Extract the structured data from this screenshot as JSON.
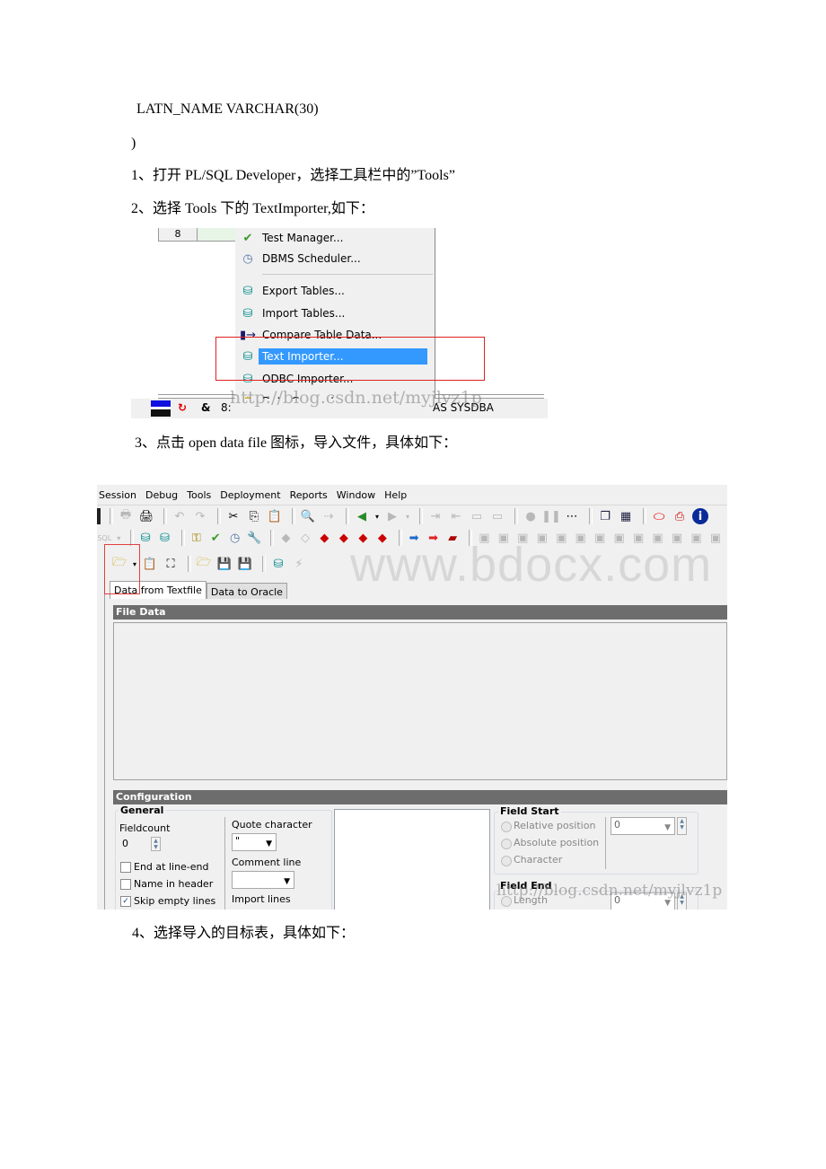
{
  "document": {
    "lines": [
      "LATN_NAME VARCHAR(30)",
      ")",
      "1、打开 PL/SQL Developer，选择工具栏中的”Tools”",
      "2、选择 Tools 下的 TextImporter,如下：",
      "3、点击 open data file 图标，导入文件，具体如下：",
      "4、选择导入的目标表，具体如下："
    ]
  },
  "screenshot1": {
    "grid_cell": "8",
    "menu_items": [
      {
        "label": "Test Manager...",
        "icon": "test-manager-icon"
      },
      {
        "label": "DBMS Scheduler...",
        "icon": "dbms-scheduler-icon"
      },
      {
        "label": "Export Tables...",
        "icon": "export-tables-icon"
      },
      {
        "label": "Import Tables...",
        "icon": "import-tables-icon"
      },
      {
        "label": "Compare Table Data...",
        "icon": "compare-table-data-icon"
      },
      {
        "label": "Text Importer...",
        "icon": "text-importer-icon",
        "selected": true
      },
      {
        "label": "ODBC Importer...",
        "icon": "odbc-importer-icon"
      },
      {
        "label": "Data Generator...",
        "icon": "data-generator-icon"
      }
    ],
    "status": {
      "amp": "&",
      "pos": "8:",
      "user": "AS SYSDBA"
    },
    "watermark": "http://blog.csdn.net/myjlvz1p"
  },
  "screenshot2": {
    "menu": [
      "Session",
      "Debug",
      "Tools",
      "Deployment",
      "Reports",
      "Window",
      "Help"
    ],
    "tabs": [
      {
        "label": "Data from Textfile",
        "active": true
      },
      {
        "label": "Data to Oracle",
        "active": false
      }
    ],
    "sections": {
      "file_data": "File Data",
      "configuration": "Configuration"
    },
    "general": {
      "title": "General",
      "fieldcount_label": "Fieldcount",
      "fieldcount_value": "0",
      "checkboxes": [
        {
          "label": "End at line-end",
          "checked": false
        },
        {
          "label": "Name in header",
          "checked": false
        },
        {
          "label": "Skip empty lines",
          "checked": true
        }
      ],
      "quote_label": "Quote character",
      "quote_value": "\"",
      "comment_label": "Comment line",
      "comment_value": "",
      "import_lines_label": "Import lines"
    },
    "field_start": {
      "title": "Field Start",
      "options": [
        "Relative position",
        "Absolute position",
        "Character"
      ],
      "value": "0"
    },
    "field_end": {
      "title": "Field End",
      "options": [
        "Length"
      ],
      "value": "0"
    },
    "watermark_site": "www.bdocx.com",
    "watermark_blog": "http://blog.csdn.net/myjlvz1p"
  }
}
